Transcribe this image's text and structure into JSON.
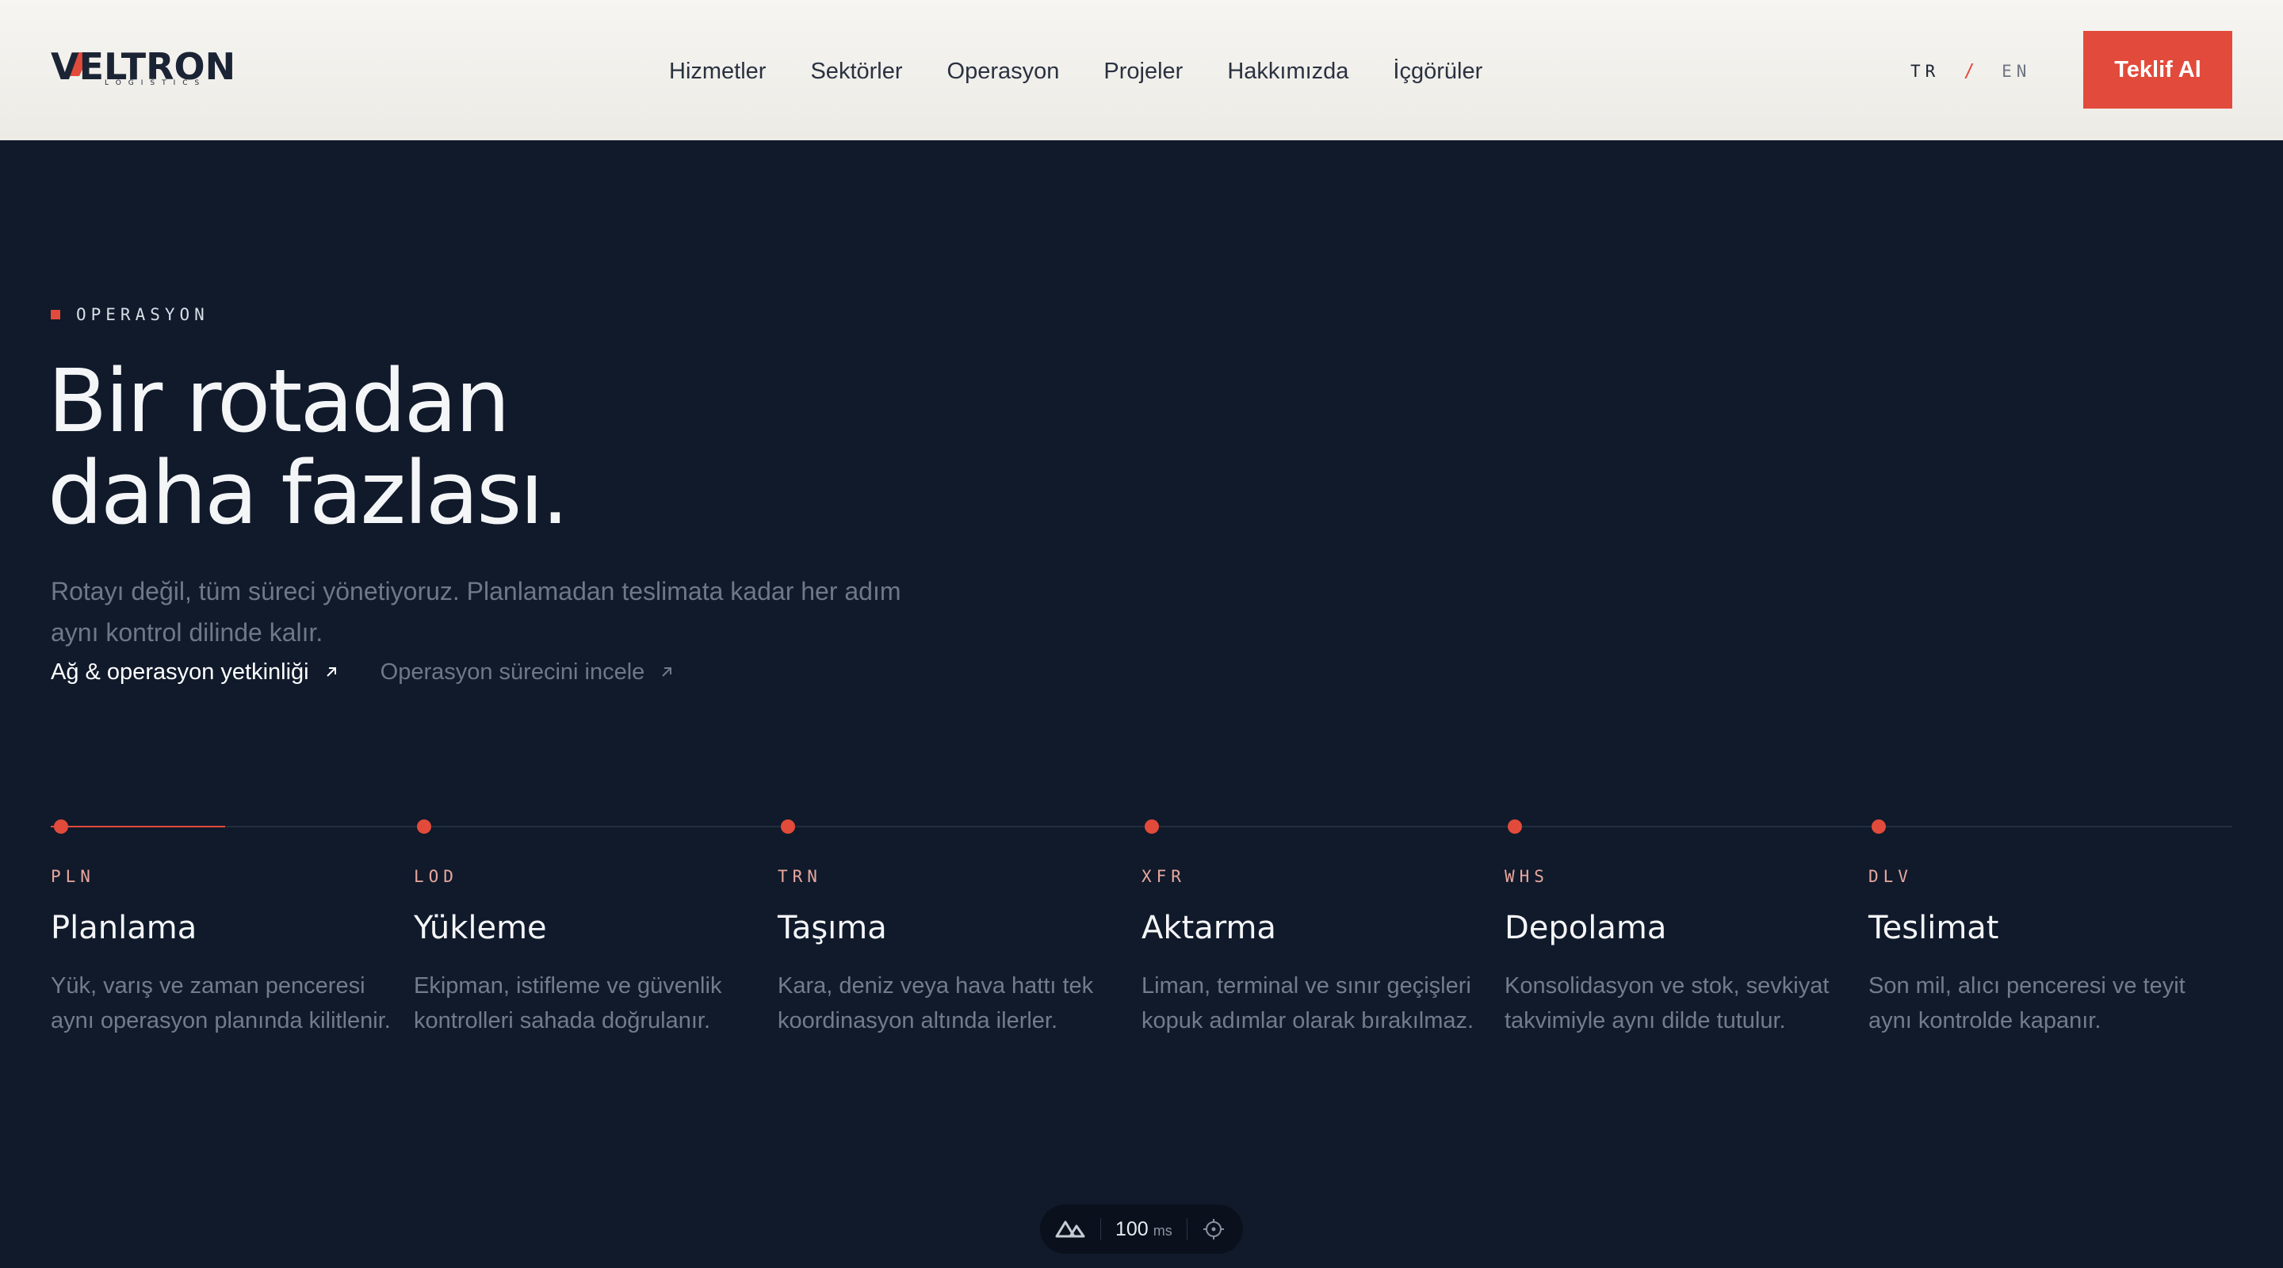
{
  "brand": {
    "name": "VELTRON",
    "tagline": "LOGISTICS",
    "accent": "#e24b3b",
    "navy": "#101a2b"
  },
  "nav": {
    "items": [
      "Hizmetler",
      "Sektörler",
      "Operasyon",
      "Projeler",
      "Hakkımızda",
      "İçgörüler"
    ]
  },
  "lang": {
    "current": "TR",
    "separator": "/",
    "other": "EN"
  },
  "cta": {
    "label": "Teklif Al"
  },
  "hero": {
    "eyebrow": "OPERASYON",
    "headline_line1": "Bir rotadan",
    "headline_line2": "daha fazlası.",
    "lead": "Rotayı değil, tüm süreci yönetiyoruz. Planlamadan teslimata kadar her adım aynı kontrol dilinde kalır.",
    "link_primary": "Ağ & operasyon yetkinliği",
    "link_secondary": "Operasyon sürecini incele",
    "link_icon": "arrow-up-right-icon"
  },
  "timeline": {
    "progress": 0.08,
    "steps": [
      {
        "code": "PLN",
        "title": "Planlama",
        "desc": "Yük, varış ve zaman penceresi aynı operasyon planında kilitlenir."
      },
      {
        "code": "LOD",
        "title": "Yükleme",
        "desc": "Ekipman, istifleme ve güvenlik kontrolleri sahada doğrulanır."
      },
      {
        "code": "TRN",
        "title": "Taşıma",
        "desc": "Kara, deniz veya hava hattı tek koordinasyon altında ilerler."
      },
      {
        "code": "XFR",
        "title": "Aktarma",
        "desc": "Liman, terminal ve sınır geçişleri kopuk adımlar olarak bırakılmaz."
      },
      {
        "code": "WHS",
        "title": "Depolama",
        "desc": "Konsolidasyon ve stok, sevkiyat takvimiyle aynı dilde tutulur."
      },
      {
        "code": "DLV",
        "title": "Teslimat",
        "desc": "Son mil, alıcı penceresi ve teyit aynı kontrolde kapanır."
      }
    ]
  },
  "devbar": {
    "value": "100",
    "unit": "ms",
    "logo_icon": "nuxt-logo-icon",
    "target_icon": "crosshair-icon"
  }
}
